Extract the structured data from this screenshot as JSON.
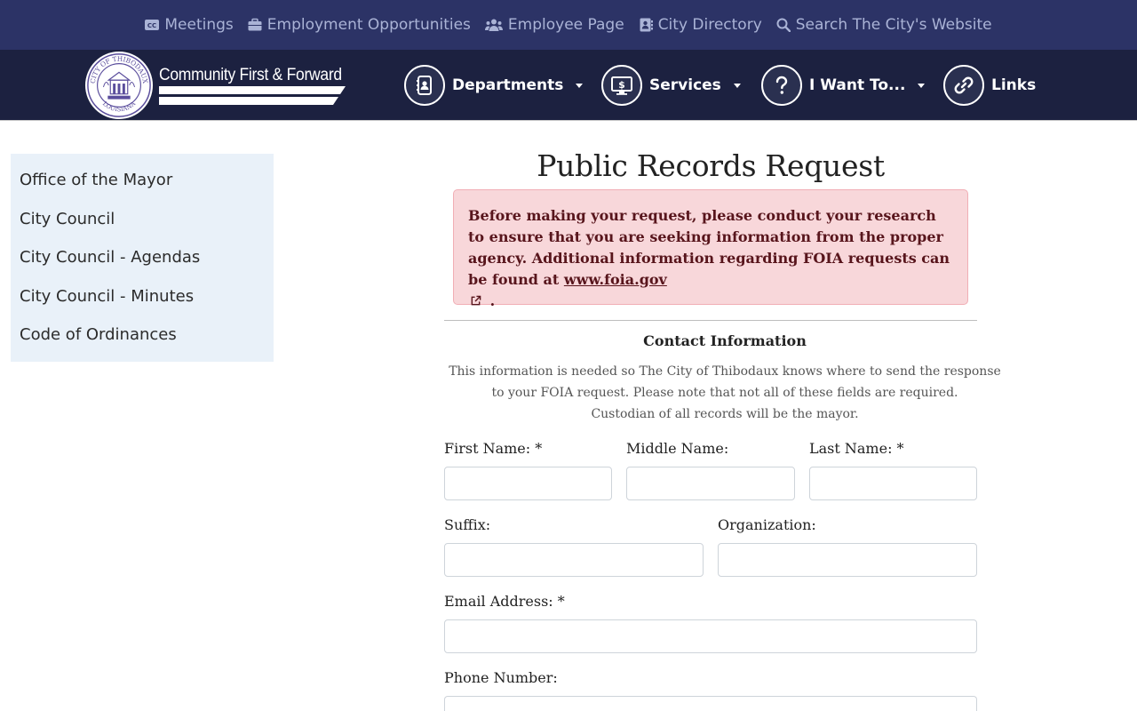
{
  "topbar": {
    "links": [
      {
        "label": "Meetings",
        "icon": "closed-caption-icon"
      },
      {
        "label": "Employment Opportunities",
        "icon": "briefcase-icon"
      },
      {
        "label": "Employee Page",
        "icon": "users-icon"
      },
      {
        "label": "City Directory",
        "icon": "address-book-icon"
      },
      {
        "label": "Search The City's Website",
        "icon": "search-icon"
      }
    ]
  },
  "logo": {
    "tagline": "Community First & Forward",
    "seal_text_top": "CITY OF THIBODAUX",
    "seal_text_bottom": "LOUISIANA"
  },
  "nav": {
    "items": [
      {
        "label": "Departments",
        "icon": "contact-book-icon",
        "dropdown": true
      },
      {
        "label": "Services",
        "icon": "monitor-dollar-icon",
        "dropdown": true
      },
      {
        "label": "I Want To...",
        "icon": "question-icon",
        "dropdown": true
      },
      {
        "label": "Links",
        "icon": "chain-link-icon",
        "dropdown": false
      }
    ]
  },
  "sidebar": {
    "items": [
      {
        "label": "Office of the Mayor"
      },
      {
        "label": "City Council"
      },
      {
        "label": "City Council - Agendas"
      },
      {
        "label": "City Council - Minutes"
      },
      {
        "label": "Code of Ordinances"
      }
    ]
  },
  "page": {
    "title": "Public Records Request",
    "alert": {
      "text": "Before making your request, please conduct your research to ensure that you are seeking information from the proper agency. Additional information regarding FOIA requests can be found at ",
      "link": "www.foia.gov",
      "suffix": "."
    },
    "section_title": "Contact Information",
    "section_desc_1": "This information is needed so The City of Thibodaux knows where to send the response to your FOIA request. Please note that not all of these fields are required.",
    "section_desc_2": "Custodian of all records will be the mayor."
  },
  "form": {
    "first_name": {
      "label": "First Name: *",
      "value": ""
    },
    "middle_name": {
      "label": "Middle Name:",
      "value": ""
    },
    "last_name": {
      "label": "Last Name: *",
      "value": ""
    },
    "suffix": {
      "label": "Suffix:",
      "value": ""
    },
    "organization": {
      "label": "Organization:",
      "value": ""
    },
    "email": {
      "label": "Email Address: *",
      "value": ""
    },
    "phone": {
      "label": "Phone Number:",
      "value": ""
    }
  },
  "colors": {
    "topbar_bg": "#2c3366",
    "nav_bg": "#1c2140",
    "sidebar_bg": "#e9f1f9",
    "alert_bg": "#f8d7da",
    "alert_text": "#58151c"
  }
}
